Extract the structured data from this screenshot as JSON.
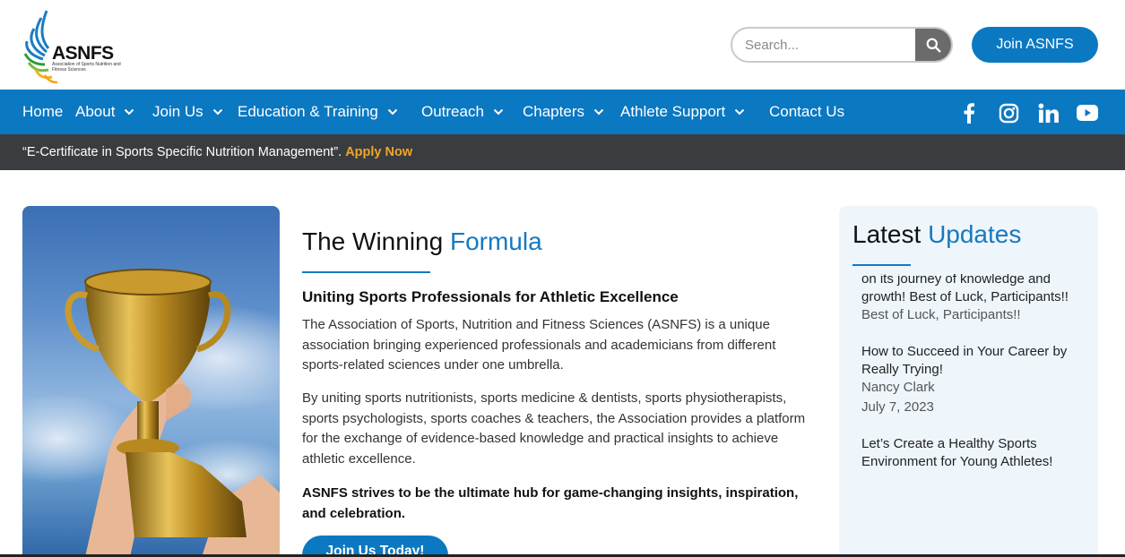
{
  "colors": {
    "brand_blue": "#0b78c2",
    "accent_orange": "#f0a526",
    "dark_bar": "#3a3d40",
    "sidebar_bg": "#eef6fc"
  },
  "header": {
    "logo_text": "ASNFS",
    "logo_sub": "Association of Sports Nutrition and Fitness Sciences",
    "search_placeholder": "Search...",
    "join_label": "Join ASNFS"
  },
  "nav": {
    "items": [
      {
        "label": "Home",
        "dropdown": false
      },
      {
        "label": "About",
        "dropdown": true
      },
      {
        "label": "Join Us",
        "dropdown": true
      },
      {
        "label": "Education & Training",
        "dropdown": true
      },
      {
        "label": "Outreach",
        "dropdown": true
      },
      {
        "label": "Chapters",
        "dropdown": true
      },
      {
        "label": "Athlete Support",
        "dropdown": true
      },
      {
        "label": "Contact Us",
        "dropdown": false
      }
    ],
    "social": [
      "facebook-icon",
      "instagram-icon",
      "linkedin-icon",
      "youtube-icon"
    ]
  },
  "announcement": {
    "text": "“E-Certificate in Sports Specific Nutrition Management”.",
    "link": "Apply Now"
  },
  "main": {
    "title_prefix": "The Winning",
    "title_accent": "Formula",
    "subtitle": "Uniting Sports Professionals for Athletic Excellence",
    "para1": "The Association of Sports, Nutrition and Fitness Sciences (ASNFS) is a unique association bringing experienced professionals and academicians from different sports-related sciences under one umbrella.",
    "para2": "By uniting sports nutritionists, sports medicine & dentists, sports physiotherapists, sports psychologists, sports coaches & teachers, the Association provides a platform for the exchange of evidence-based knowledge and practical insights to achieve athletic excellence.",
    "para3": "ASNFS strives to be the ultimate hub for game-changing insights, inspiration, and celebration.",
    "cta": "Join Us Today!"
  },
  "sidebar": {
    "title_prefix": "Latest",
    "title_accent": "Updates",
    "updates": [
      {
        "title": "on its journey of knowledge and growth! Best of Luck, Participants!!",
        "meta1": "Best of Luck, Participants!!",
        "meta2": ""
      },
      {
        "title": "How to Succeed in Your Career by Really Trying!",
        "meta1": "Nancy Clark",
        "meta2": "July 7, 2023"
      },
      {
        "title": "Let’s Create a Healthy Sports Environment for Young Athletes!",
        "meta1": "",
        "meta2": ""
      }
    ]
  }
}
